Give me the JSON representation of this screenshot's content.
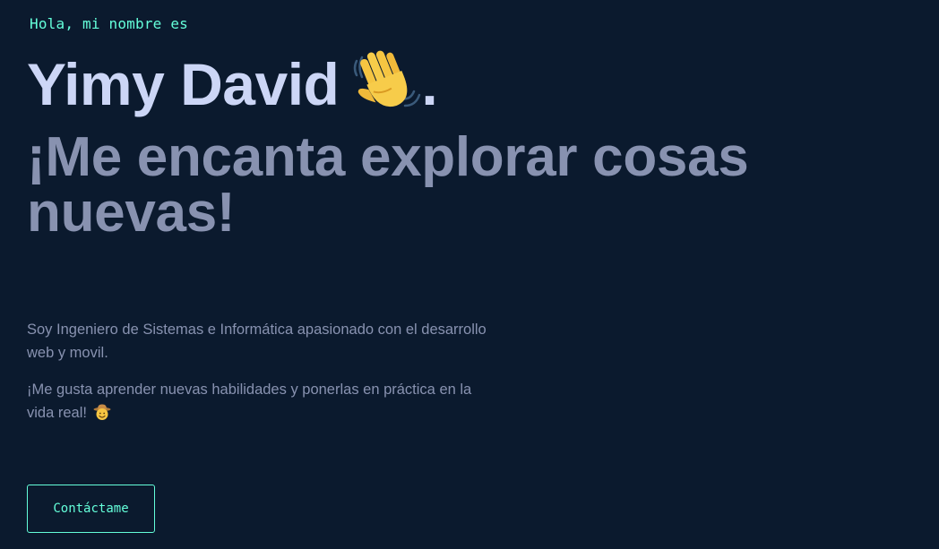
{
  "hero": {
    "greeting": "Hola, mi nombre es",
    "name": "Yimy David",
    "name_suffix": ".",
    "tagline_line1": "¡Me encanta explorar cosas",
    "tagline_line2": "nuevas!",
    "wave_icon": "waving-hand-emoji",
    "bio": {
      "paragraph1": "Soy Ingeniero de Sistemas e Informática apasionado con el desarrollo web y movil.",
      "paragraph2": "¡Me gusta aprender nuevas habilidades y ponerlas en práctica en la vida real!",
      "paragraph2_icon": "cowboy-hat-face-emoji"
    },
    "cta_label": "Contáctame"
  },
  "colors": {
    "background": "#0b1a2e",
    "accent": "#64ffda",
    "heading": "#ccd6f6",
    "muted": "#8892b0"
  }
}
